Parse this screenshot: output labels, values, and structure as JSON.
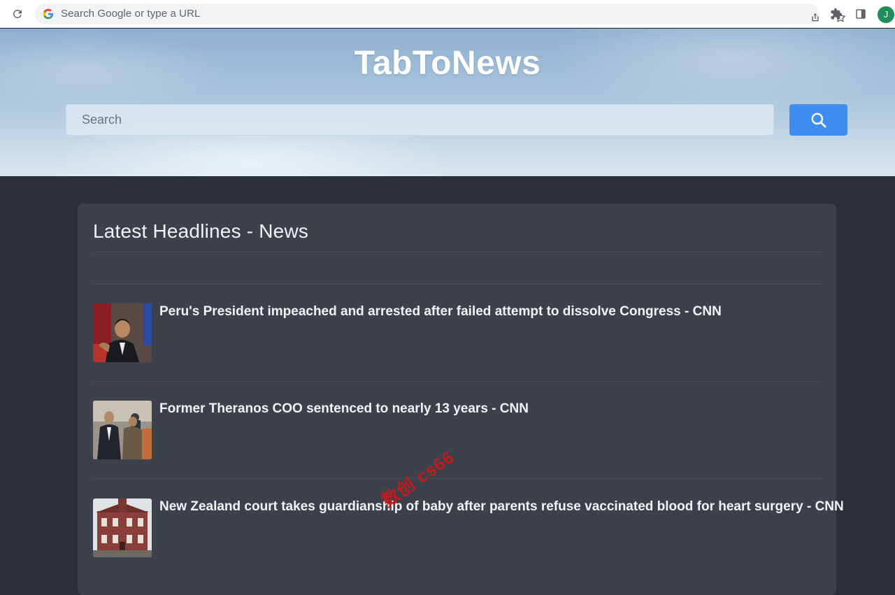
{
  "browser": {
    "omnibox_placeholder": "Search Google or type a URL",
    "profile_initial": "J"
  },
  "hero": {
    "site_title": "TabToNews",
    "search_placeholder": "Search"
  },
  "news": {
    "title": "Latest Headlines - News",
    "items": [
      {
        "headline": "Peru's President impeached and arrested after failed attempt to dissolve Congress - CNN"
      },
      {
        "headline": "Former Theranos COO sentenced to nearly 13 years - CNN"
      },
      {
        "headline": "New Zealand court takes guardianship of baby after parents refuse vaccinated blood for heart surgery - CNN"
      }
    ]
  },
  "watermark": "数创 cs66",
  "colors": {
    "accent": "#3d8ef0",
    "card_bg": "#3c414c",
    "page_bg": "#2b2f38",
    "avatar": "#1e8e5a"
  }
}
